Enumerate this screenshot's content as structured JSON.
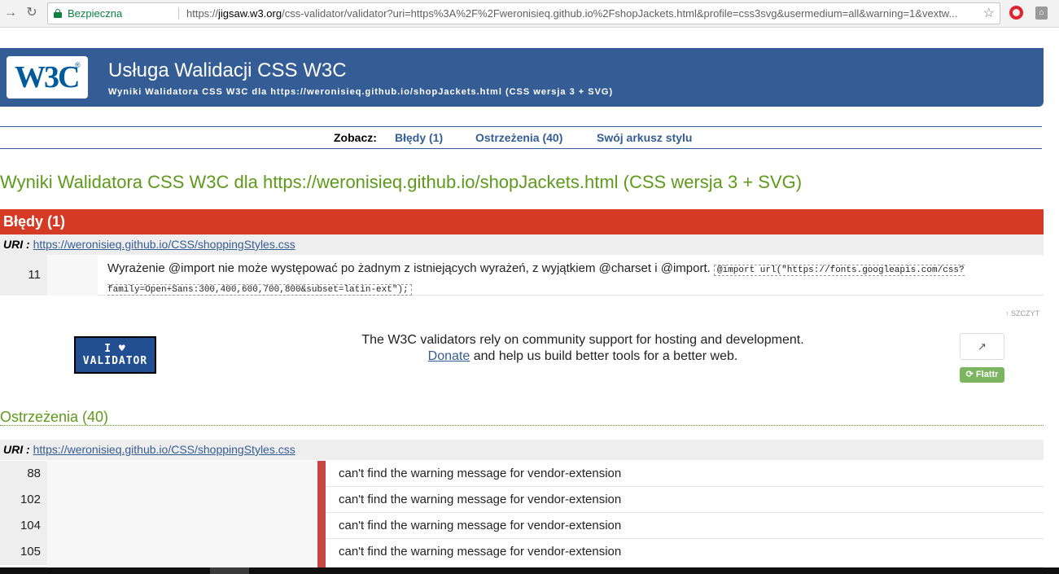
{
  "browser": {
    "secure_label": "Bezpieczna",
    "url_prefix": "https://",
    "url_host": "jigsaw.w3.org",
    "url_rest": "/css-validator/validator?uri=https%3A%2F%2Fweronisieq.github.io%2FshopJackets.html&profile=css3svg&usermedium=all&warning=1&vextw..."
  },
  "header": {
    "logo_text": "W3C",
    "logo_reg": "®",
    "title": "Usługa Walidacji CSS W3C",
    "subtitle": "Wyniki Walidatora CSS W3C dla https://weronisieq.github.io/shopJackets.html (CSS wersja 3 + SVG)"
  },
  "nav": {
    "label": "Zobacz:",
    "errors_link": "Błędy (1)",
    "warnings_link": "Ostrzeżenia (40)",
    "stylesheet_link": "Swój arkusz stylu"
  },
  "results_title": "Wyniki Walidatora CSS W3C dla https://weronisieq.github.io/shopJackets.html (CSS wersja 3 + SVG)",
  "errors": {
    "heading": "Błędy (1)",
    "uri_label": "URI :",
    "uri": "https://weronisieq.github.io/CSS/shoppingStyles.css",
    "rows": [
      {
        "line": "11",
        "message": "Wyrażenie @import nie może występować po żadnym z istniejących wyrażeń, z wyjątkiem @charset i @import.",
        "code": "@import url(\"https://fonts.googleapis.com/css?family=Open+Sans:300,400,600,700,800&subset=latin-ext\");"
      }
    ]
  },
  "top_link": "↑ SZCZYT",
  "donation": {
    "badge_line1": "I ♥",
    "badge_line2": "VALIDATOR",
    "text1": "The W3C validators rely on community support for hosting and development.",
    "donate": "Donate",
    "text2": "and help us build better tools for a better web.",
    "flattr": "Flattr"
  },
  "warnings": {
    "heading": "Ostrzeżenia (40)",
    "uri_label": "URI :",
    "uri": "https://weronisieq.github.io/CSS/shoppingStyles.css",
    "rows": [
      {
        "line": "88",
        "message": "can't find the warning message for vendor-extension"
      },
      {
        "line": "102",
        "message": "can't find the warning message for vendor-extension"
      },
      {
        "line": "104",
        "message": "can't find the warning message for vendor-extension"
      },
      {
        "line": "105",
        "message": "can't find the warning message for vendor-extension"
      }
    ]
  },
  "colors": {
    "banner": "#355d95",
    "error_header": "#d53a24",
    "heading_green": "#5e9a1a",
    "warning_bar": "#c74545"
  }
}
